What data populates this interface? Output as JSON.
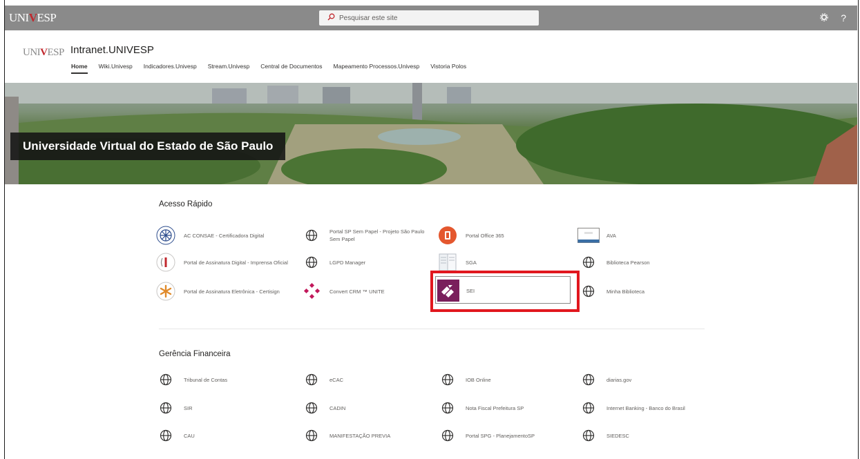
{
  "suitebar": {
    "logo_text_left": "UNI",
    "logo_text_v": "V",
    "logo_text_right": "ESP",
    "search_placeholder": "Pesquisar este site",
    "settings_icon": "gear-icon",
    "help_label": "?"
  },
  "site": {
    "logo_left": "UNI",
    "logo_v": "V",
    "logo_right": "ESP",
    "title": "Intranet.UNIVESP",
    "nav": [
      {
        "label": "Home"
      },
      {
        "label": "Wiki.Univesp"
      },
      {
        "label": "Indicadores.Univesp"
      },
      {
        "label": "Stream.Univesp"
      },
      {
        "label": "Central de Documentos"
      },
      {
        "label": "Mapeamento Processos.Univesp"
      },
      {
        "label": "Vistoria Polos"
      }
    ]
  },
  "hero": {
    "caption": "Universidade Virtual do Estado de São Paulo"
  },
  "quick_access": {
    "title": "Acesso Rápido",
    "items": [
      {
        "label": "AC CONSAE - Certificadora Digital",
        "icon": "consae-logo-icon"
      },
      {
        "label": "Portal SP Sem Papel - Projeto São Paulo Sem Papel",
        "icon": "globe-icon"
      },
      {
        "label": "Portal Office 365",
        "icon": "office-icon"
      },
      {
        "label": "AVA",
        "icon": "ava-thumbnail-icon"
      },
      {
        "label": "Portal de Assinatura Digital - Imprensa Oficial",
        "icon": "imprensa-oficial-logo-icon"
      },
      {
        "label": "LGPD Manager",
        "icon": "globe-icon"
      },
      {
        "label": "SGA",
        "icon": "document-icon"
      },
      {
        "label": "Biblioteca Pearson",
        "icon": "globe-icon"
      },
      {
        "label": "Portal de Assinatura Eletrônica - Certisign",
        "icon": "certisign-logo-icon"
      },
      {
        "label": "Convert CRM ™ UNITE",
        "icon": "convert-crm-logo-icon"
      },
      {
        "label": "SEI",
        "icon": "sei-logo-icon"
      },
      {
        "label": "Minha Biblioteca",
        "icon": "globe-icon"
      }
    ]
  },
  "finance": {
    "title": "Gerência Financeira",
    "items": [
      {
        "label": "Tribunal de Contas"
      },
      {
        "label": "eCAC"
      },
      {
        "label": "IOB Online"
      },
      {
        "label": "diarias.gov"
      },
      {
        "label": "SIR"
      },
      {
        "label": "CADIN"
      },
      {
        "label": "Nota Fiscal Prefeitura SP"
      },
      {
        "label": "Internet Banking - Banco do Brasil"
      },
      {
        "label": "CAU"
      },
      {
        "label": "MANIFESTAÇÃO PREVIA"
      },
      {
        "label": "Portal SPG - PlanejamentoSP"
      },
      {
        "label": "SIEDESC"
      }
    ]
  },
  "colors": {
    "suitebar": "#8a8a8a",
    "highlight": "#e1171e",
    "brand_red": "#c1272d",
    "office": "#e4572e",
    "sei": "#7a1f5c"
  }
}
